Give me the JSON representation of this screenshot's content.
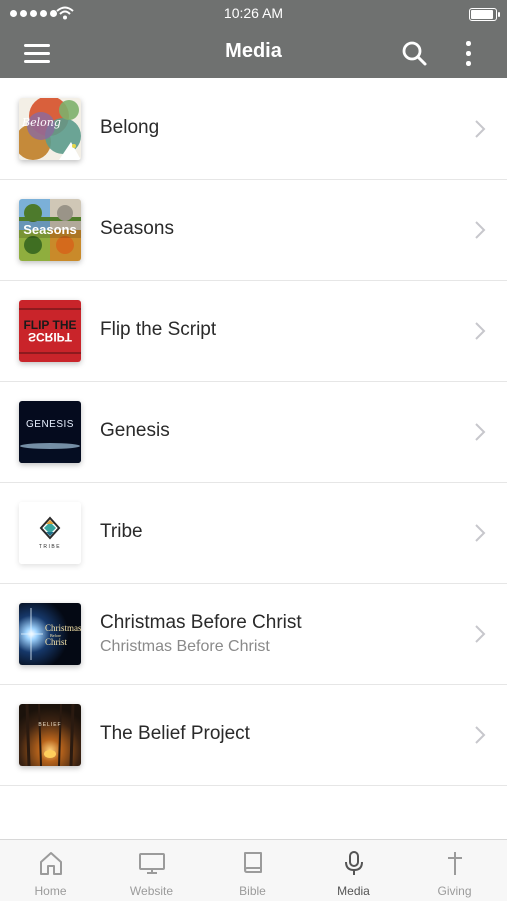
{
  "status_bar": {
    "time": "10:26 AM"
  },
  "nav": {
    "title": "Media"
  },
  "items": [
    {
      "title": "Belong",
      "thumb": "belong"
    },
    {
      "title": "Seasons",
      "thumb": "seasons",
      "thumb_text": "Seasons"
    },
    {
      "title": "Flip the Script",
      "thumb": "flip",
      "thumb_text_top": "FLIP THE",
      "thumb_text_bottom": "SCRIPT"
    },
    {
      "title": "Genesis",
      "thumb": "genesis",
      "thumb_text": "GENESIS"
    },
    {
      "title": "Tribe",
      "thumb": "tribe",
      "thumb_text": "TRIBE"
    },
    {
      "title": "Christmas Before Christ",
      "subtitle": "Christmas Before Christ",
      "thumb": "christmas"
    },
    {
      "title": "The Belief Project",
      "thumb": "belief"
    }
  ],
  "tabs": [
    {
      "label": "Home",
      "icon": "home-icon"
    },
    {
      "label": "Website",
      "icon": "monitor-icon"
    },
    {
      "label": "Bible",
      "icon": "book-icon"
    },
    {
      "label": "Media",
      "icon": "microphone-icon",
      "active": true
    },
    {
      "label": "Giving",
      "icon": "cross-icon"
    }
  ],
  "colors": {
    "header": "#6f7170",
    "tab_active": "#555555",
    "tab_inactive": "#9b9b9b"
  }
}
